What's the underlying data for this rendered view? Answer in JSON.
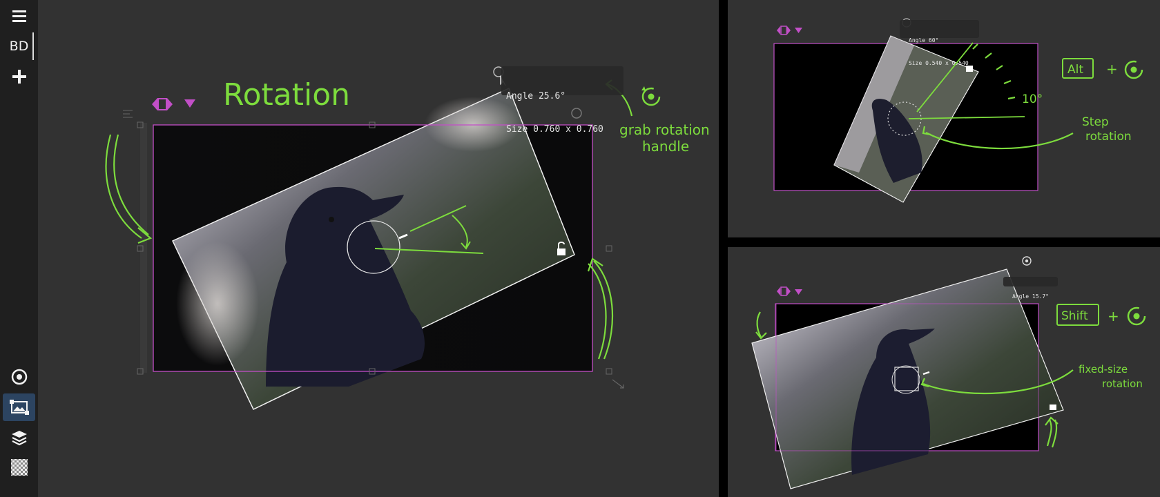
{
  "sidebar": {
    "items": [
      {
        "name": "menu",
        "icon": "hamburger-icon"
      },
      {
        "name": "board",
        "label": "BD"
      },
      {
        "name": "add",
        "icon": "plus-icon"
      },
      {
        "name": "target",
        "icon": "target-icon"
      },
      {
        "name": "image-edit",
        "icon": "image-transform-icon",
        "active": true
      },
      {
        "name": "layers",
        "icon": "layers-icon"
      },
      {
        "name": "transparency",
        "icon": "checkerboard-icon"
      }
    ]
  },
  "main": {
    "title": "Rotation",
    "tooltip": {
      "angle": "Angle 25.6°",
      "size": "Size 0.760 x 0.760"
    },
    "annotation_line1": "grab rotation",
    "annotation_line2": "handle"
  },
  "top_right": {
    "tooltip": {
      "angle": "Angle 60°",
      "size": "Size 0.540 x 0.540"
    },
    "key": "Alt",
    "plus": "+",
    "step_label": "10°",
    "annotation_line1": "Step",
    "annotation_line2": "rotation"
  },
  "bottom_right": {
    "tooltip": {
      "angle": "Angle 15.7°"
    },
    "key": "Shift",
    "plus": "+",
    "annotation_line1": "fixed-size",
    "annotation_line2": "rotation"
  },
  "colors": {
    "accent": "#7ddc3d",
    "frame": "#c24fc7",
    "sidebar_bg": "#1f1f1f",
    "canvas_bg": "#323232",
    "active_tool": "#2c4461"
  }
}
